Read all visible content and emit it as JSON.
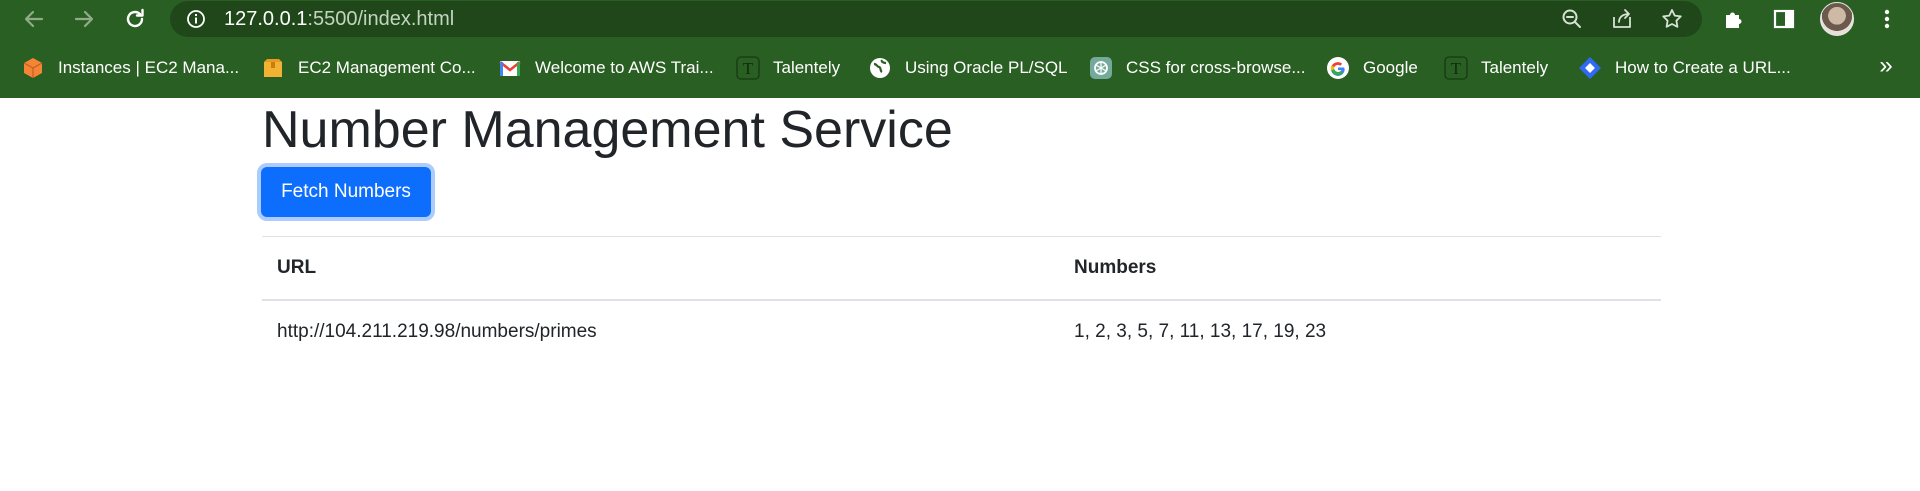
{
  "browser": {
    "url": {
      "host": "127.0.0.1",
      "rest": ":5500/index.html"
    },
    "icons": {
      "back": "back-arrow-icon",
      "forward": "forward-arrow-icon",
      "reload": "reload-icon",
      "site_info": "info-icon",
      "zoom": "zoom-out-icon",
      "share": "share-icon",
      "bookmark": "star-icon",
      "extensions": "puzzle-icon",
      "side_panel": "side-panel-icon",
      "menu": "kebab-menu-icon"
    },
    "colors": {
      "frame": "#2a5f23",
      "omnibox": "#1f4719"
    },
    "bookmarks": [
      {
        "label": "Instances | EC2 Mana...",
        "icon": "aws-ec2-icon"
      },
      {
        "label": "EC2 Management Co...",
        "icon": "aws-ec2-icon"
      },
      {
        "label": "Welcome to AWS Trai...",
        "icon": "gmail-icon"
      },
      {
        "label": "Talentely",
        "icon": "talentely-icon"
      },
      {
        "label": "Using Oracle PL/SQL",
        "icon": "globe-icon"
      },
      {
        "label": "CSS for cross-browse...",
        "icon": "chatgpt-icon"
      },
      {
        "label": "Google",
        "icon": "google-icon"
      },
      {
        "label": "Talentely",
        "icon": "talentely-icon"
      },
      {
        "label": "How to Create a URL...",
        "icon": "diamond-icon"
      }
    ],
    "more_bookmarks": "»"
  },
  "page": {
    "title": "Number Management Service",
    "fetch_button": "Fetch Numbers",
    "accent": "#0d6efd",
    "table": {
      "headers": [
        "URL",
        "Numbers"
      ],
      "rows": [
        [
          "http://104.211.219.98/numbers/primes",
          "1, 2, 3, 5, 7, 11, 13, 17, 19, 23"
        ]
      ]
    }
  }
}
